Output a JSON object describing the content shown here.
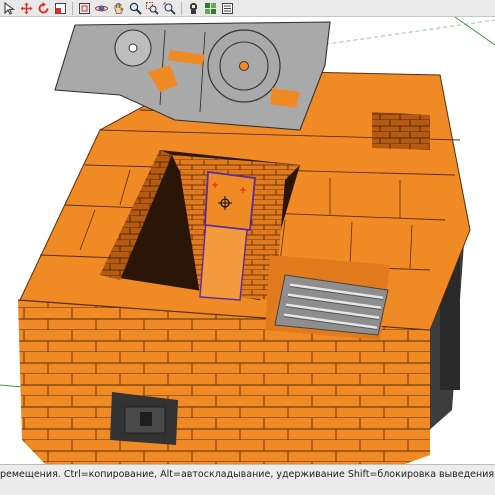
{
  "toolbar": {
    "tools": [
      {
        "name": "select-arrow-icon",
        "color": "#333333"
      },
      {
        "name": "move-icon",
        "color": "#d9342b"
      },
      {
        "name": "rotate-icon",
        "color": "#d9342b"
      },
      {
        "name": "scale-icon",
        "color": "#c0392b"
      },
      {
        "name": "offset-icon",
        "color": "#444444"
      },
      {
        "name": "orbit-icon",
        "color": "#444444"
      },
      {
        "name": "pan-hand-icon",
        "color": "#8a6d3b"
      },
      {
        "name": "zoom-icon",
        "color": "#444444"
      },
      {
        "name": "zoom-window-icon",
        "color": "#444444"
      },
      {
        "name": "zoom-extents-icon",
        "color": "#444444"
      },
      {
        "name": "walk-icon",
        "color": "#444444"
      },
      {
        "name": "components-icon",
        "color": "#2e7d32"
      },
      {
        "name": "outliner-icon",
        "color": "#444444"
      }
    ]
  },
  "status": {
    "text": "ремещения. Ctrl=копирование, Alt=автоскладывание, удерживание Shift=блокировка выведения"
  },
  "colors": {
    "brick": "#f08a24",
    "brick_dark": "#d9731a",
    "mortar": "#5a2e0e",
    "plate": "#a9a9a9",
    "selection": "#5b2ca0"
  }
}
